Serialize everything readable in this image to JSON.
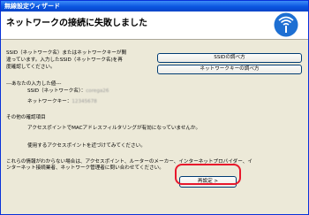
{
  "window": {
    "title": "無線設定ウィザード"
  },
  "header": {
    "title": "ネットワークの接続に失敗しました"
  },
  "message": {
    "line1": "SSID（ネットワーク名）またはネットワークキーが間",
    "line2": "違っています。入力したSSID（ネットワーク名)を再",
    "line3": "度確認してください。"
  },
  "buttons": {
    "ssid_help": "SSIDの調べ方",
    "key_help": "ネットワークキーの調べ方",
    "reset": "再設定 >"
  },
  "input_info": {
    "heading": "---あなたの入力した値---",
    "ssid_label": "SSID（ネットワーク名）：",
    "ssid_value": "corega26",
    "key_label": "ネットワークキー：",
    "key_value": "12345678"
  },
  "other": {
    "heading": "その他の確認項目",
    "item1": "アクセスポイントでMACアドレスフィルタリングが有効になっていませんか。",
    "item2": "使用するアクセスポイントを近づけてみてください。"
  },
  "footer": {
    "line1": "これらの情報がわからない場合は、アクセスポイント、ルーターのメーカー、インターネットプロバイダー、イ",
    "line2": "ンターネット接続業者、ネットワーク管理者に問い合わせてください。"
  },
  "colors": {
    "title_bar": "#0a55e0",
    "highlight": "#e8182c",
    "logo": "#1d6fd3"
  },
  "icons": {
    "logo": "wireless-logo-icon"
  }
}
